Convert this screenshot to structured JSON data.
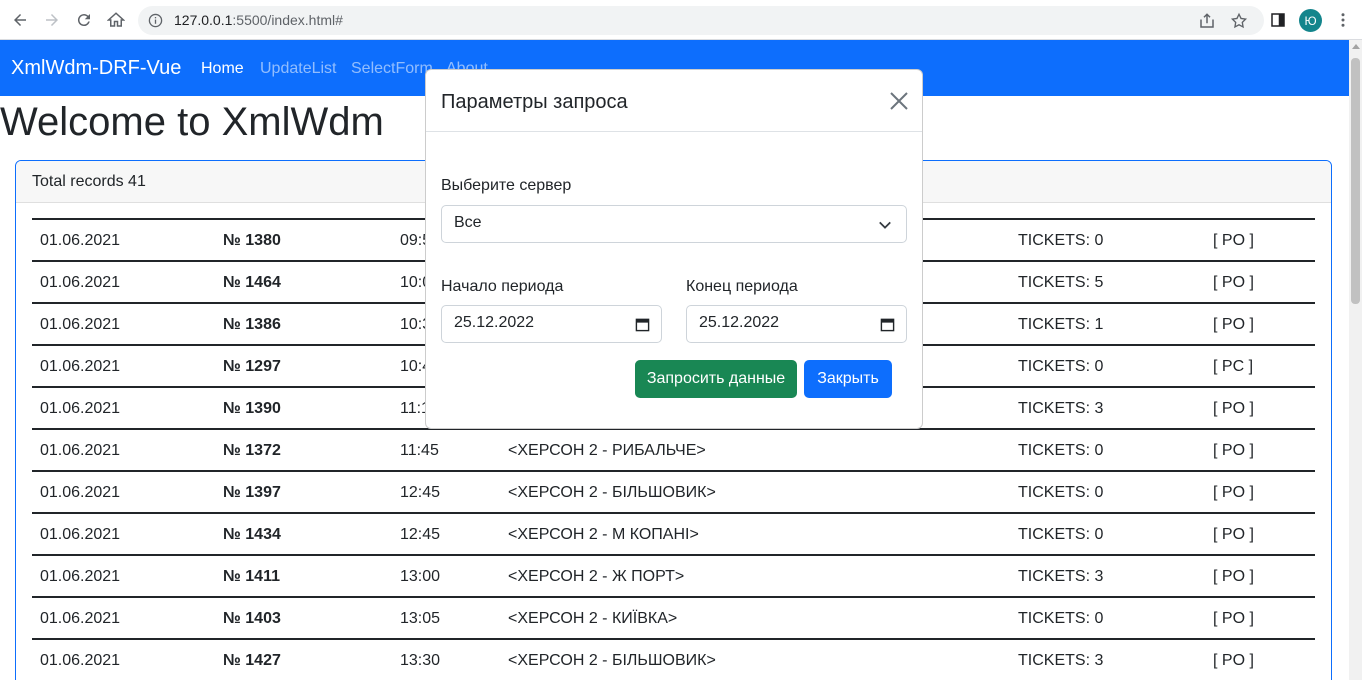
{
  "browser": {
    "url_host": "127.0.0.1",
    "url_rest": ":5500/index.html#",
    "profile_initial": "Ю"
  },
  "navbar": {
    "brand": "XmlWdm-DRF-Vue",
    "links": [
      "Home",
      "UpdateList",
      "SelectForm",
      "About"
    ]
  },
  "page": {
    "title": "Welcome to XmlWdm",
    "total_records": "Total records 41"
  },
  "records": [
    {
      "date": "01.06.2021",
      "number": "№ 1380",
      "time": "09:5",
      "route": "",
      "tickets": "TICKETS: 0",
      "status": "[ PO ]"
    },
    {
      "date": "01.06.2021",
      "number": "№ 1464",
      "time": "10:0",
      "route": "",
      "tickets": "TICKETS: 5",
      "status": "[ PO ]"
    },
    {
      "date": "01.06.2021",
      "number": "№ 1386",
      "time": "10:3",
      "route": "",
      "tickets": "TICKETS: 1",
      "status": "[ PO ]"
    },
    {
      "date": "01.06.2021",
      "number": "№ 1297",
      "time": "10:4",
      "route": "",
      "tickets": "TICKETS: 0",
      "status": "[ PC ]"
    },
    {
      "date": "01.06.2021",
      "number": "№ 1390",
      "time": "11:1",
      "route": "",
      "tickets": "TICKETS: 3",
      "status": "[ PO ]"
    },
    {
      "date": "01.06.2021",
      "number": "№ 1372",
      "time": "11:45",
      "route": "<ХЕРСОН 2 - РИБАЛЬЧЕ>",
      "tickets": "TICKETS: 0",
      "status": "[ PO ]"
    },
    {
      "date": "01.06.2021",
      "number": "№ 1397",
      "time": "12:45",
      "route": "<ХЕРСОН 2 - БІЛЬШОВИК>",
      "tickets": "TICKETS: 0",
      "status": "[ PO ]"
    },
    {
      "date": "01.06.2021",
      "number": "№ 1434",
      "time": "12:45",
      "route": "<ХЕРСОН 2 - М КОПАНІ>",
      "tickets": "TICKETS: 0",
      "status": "[ PO ]"
    },
    {
      "date": "01.06.2021",
      "number": "№ 1411",
      "time": "13:00",
      "route": "<ХЕРСОН 2 - Ж ПОРТ>",
      "tickets": "TICKETS: 3",
      "status": "[ PO ]"
    },
    {
      "date": "01.06.2021",
      "number": "№ 1403",
      "time": "13:05",
      "route": "<ХЕРСОН 2 - КИЇВКА>",
      "tickets": "TICKETS: 0",
      "status": "[ PO ]"
    },
    {
      "date": "01.06.2021",
      "number": "№ 1427",
      "time": "13:30",
      "route": "<ХЕРСОН 2 - БІЛЬШОВИК>",
      "tickets": "TICKETS: 3",
      "status": "[ PO ]"
    }
  ],
  "modal": {
    "title": "Параметры запроса",
    "server_label": "Выберите сервер",
    "server_value": "Все",
    "start_label": "Начало периода",
    "start_value": "25.12.2022",
    "end_label": "Конец периода",
    "end_value": "25.12.2022",
    "request_button": "Запросить данные",
    "close_button": "Закрыть"
  },
  "colors": {
    "primary": "#0d6efd",
    "success": "#198754"
  }
}
